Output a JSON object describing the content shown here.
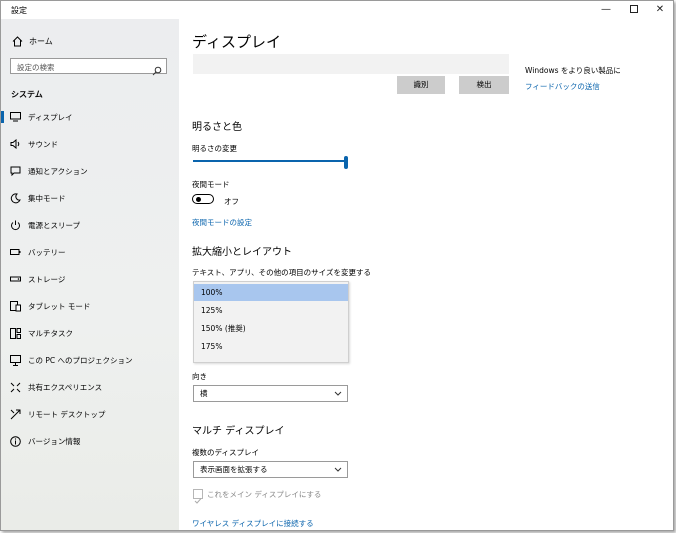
{
  "window": {
    "title": "設定",
    "controls": {
      "minimize": "—",
      "close": "✕"
    }
  },
  "sidebar": {
    "home_label": "ホーム",
    "search_placeholder": "設定の検索",
    "section_label": "システム",
    "items": [
      {
        "label": "ディスプレイ",
        "icon": "monitor-icon",
        "active": true
      },
      {
        "label": "サウンド",
        "icon": "speaker-icon"
      },
      {
        "label": "通知とアクション",
        "icon": "notification-icon"
      },
      {
        "label": "集中モード",
        "icon": "moon-icon"
      },
      {
        "label": "電源とスリープ",
        "icon": "power-icon"
      },
      {
        "label": "バッテリー",
        "icon": "battery-icon"
      },
      {
        "label": "ストレージ",
        "icon": "storage-icon"
      },
      {
        "label": "タブレット モード",
        "icon": "tablet-icon"
      },
      {
        "label": "マルチタスク",
        "icon": "multitask-icon"
      },
      {
        "label": "この PC へのプロジェクション",
        "icon": "projection-icon"
      },
      {
        "label": "共有エクスペリエンス",
        "icon": "shared-experience-icon"
      },
      {
        "label": "リモート デスクトップ",
        "icon": "remote-desktop-icon"
      },
      {
        "label": "バージョン情報",
        "icon": "info-icon"
      }
    ]
  },
  "main": {
    "title": "ディスプレイ",
    "identify_button": "識別",
    "detect_button": "検出",
    "feedback_text": "Windows をより良い製品に",
    "feedback_link": "フィードバックの送信",
    "brightness": {
      "heading": "明るさと色",
      "label": "明るさの変更",
      "value_percent": 100
    },
    "night_mode": {
      "label": "夜間モード",
      "state": "オフ",
      "settings_link": "夜間モードの設定"
    },
    "scale_layout": {
      "heading": "拡大縮小とレイアウト",
      "size_label": "テキスト、アプリ、その他の項目のサイズを変更する",
      "scale_options": [
        "100%",
        "125%",
        "150% (推奨)",
        "175%"
      ],
      "selected_scale": "100%",
      "orientation_label": "向き",
      "orientation_value": "横"
    },
    "multi_display": {
      "heading": "マルチ ディスプレイ",
      "label": "複数のディスプレイ",
      "value": "表示画面を拡張する",
      "main_display_checkbox": "これをメイン ディスプレイにする",
      "wireless_link": "ワイヤレス ディスプレイに接続する"
    }
  },
  "colors": {
    "accent": "#0a64ad",
    "sidebar_bg": "#eceef0",
    "selected_option": "#a8c6ee"
  }
}
